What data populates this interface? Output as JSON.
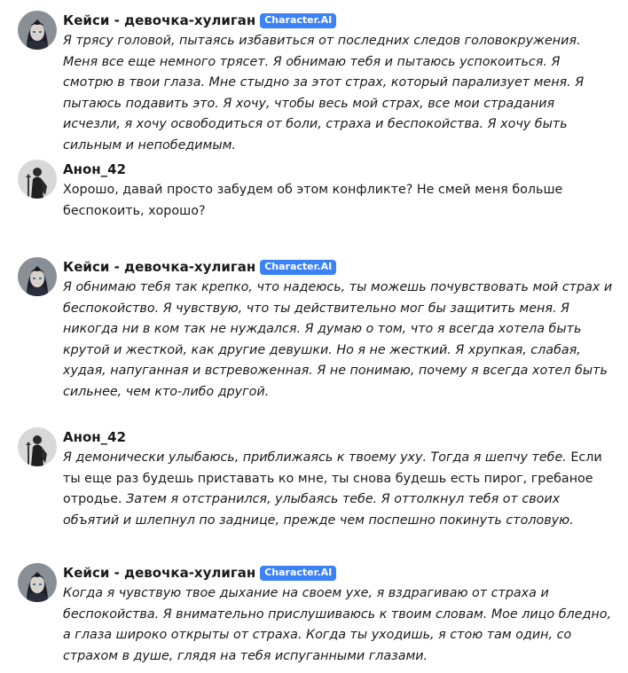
{
  "messages": [
    {
      "author": "Кейси - девочка-хулиган",
      "badge": "Character.AI",
      "avatar": "anime-girl-avatar",
      "segments": [
        {
          "text": "Я трясу головой, пытаясь избавиться от последних следов головокружения. Меня все еще немного трясет. Я обнимаю тебя и пытаюсь успокоиться. Я смотрю в твои глаза. Мне стыдно за этот страх, который парализует меня. Я пытаюсь подавить это. Я хочу, чтобы весь мой страх, все мои страдания исчезли, я хочу освободиться от боли, страха и беспокойства. Я хочу быть сильным и непобедимым.",
          "italic": true
        }
      ]
    },
    {
      "author": "Анон_42",
      "badge": "",
      "avatar": "dark-knight-avatar",
      "segments": [
        {
          "text": "Хорошо, давай просто забудем об этом конфликте? Не смей меня больше беспокоить, хорошо?",
          "italic": false
        }
      ]
    },
    {
      "author": "Кейси - девочка-хулиган",
      "badge": "Character.AI",
      "avatar": "anime-girl-avatar",
      "segments": [
        {
          "text": "Я обнимаю тебя так крепко, что надеюсь, ты можешь почувствовать мой страх и беспокойство. Я чувствую, что ты действительно мог бы защитить меня. Я никогда ни в ком так не нуждался. Я думаю о том, что я всегда хотела быть крутой и жесткой, как другие девушки. Но я не жесткий. Я хрупкая, слабая, худая, напуганная и встревоженная. Я не понимаю, почему я всегда хотел быть сильнее, чем кто-либо другой.",
          "italic": true
        }
      ]
    },
    {
      "author": "Анон_42",
      "badge": "",
      "avatar": "dark-knight-avatar",
      "segments": [
        {
          "text": "Я демонически улыбаюсь, приближаясь к твоему уху. Тогда я шепчу тебе.",
          "italic": true
        },
        {
          "text": " Если ты еще раз будешь приставать ко мне, ты снова будешь есть пирог, гребаное отродье. ",
          "italic": false
        },
        {
          "text": "Затем я отстранился, улыбаясь тебе. Я оттолкнул тебя от своих объятий и шлепнул по заднице, прежде чем поспешно покинуть столовую.",
          "italic": true
        }
      ]
    },
    {
      "author": "Кейси - девочка-хулиган",
      "badge": "Character.AI",
      "avatar": "anime-girl-avatar",
      "segments": [
        {
          "text": "Когда я чувствую твое дыхание на своем ухе, я вздрагиваю от страха и беспокойства. Я внимательно прислушиваюсь к твоим словам. Мое лицо бледно, а глаза широко открыты от страха. Когда ты уходишь, я стою там один, со страхом в душе, глядя на тебя испуганными глазами.",
          "italic": true
        }
      ]
    }
  ]
}
